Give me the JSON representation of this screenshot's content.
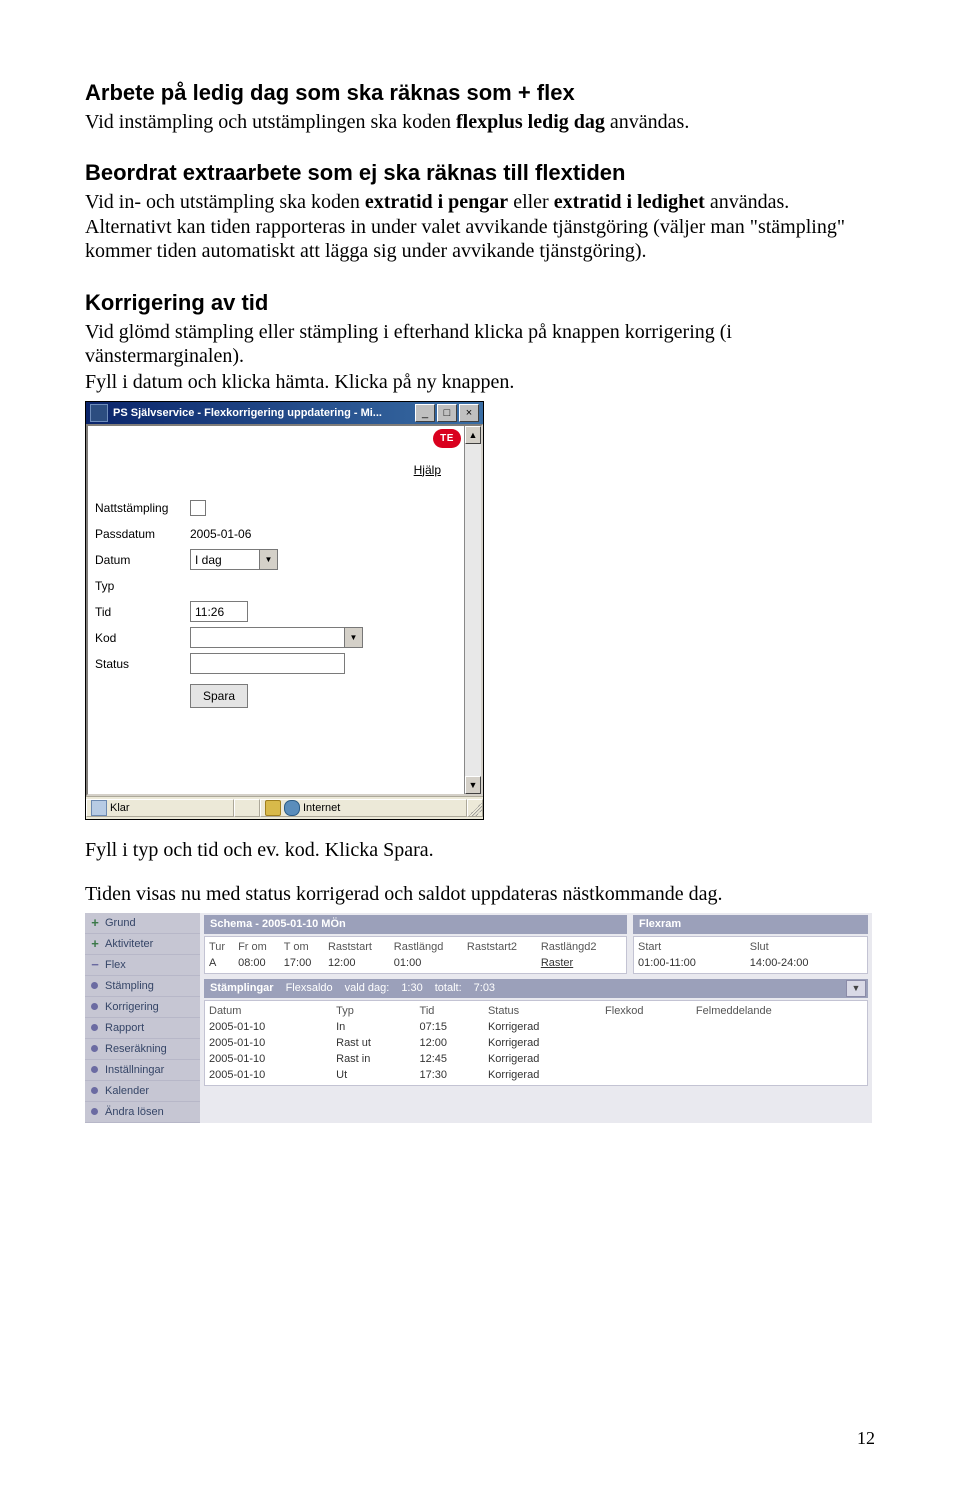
{
  "doc": {
    "h1": "Arbete på ledig dag som ska räknas som + flex",
    "p1a": "Vid instämpling och utstämplingen ska koden ",
    "p1b": "flexplus ledig dag",
    "p1c": " användas.",
    "h2": "Beordrat extraarbete som ej ska räknas till flextiden",
    "p2a": "Vid in- och utstämpling ska koden ",
    "p2b": "extratid i pengar",
    "p2c": " eller ",
    "p2d": "extratid i ledighet",
    "p2e": " användas. Alternativt kan tiden rapporteras in under valet avvikande tjänstgöring (väljer man \"stämpling\" kommer tiden automatiskt att lägga sig under avvikande tjänstgöring).",
    "h3": "Korrigering av tid",
    "p3": "Vid glömd stämpling eller stämpling i efterhand klicka på knappen korrigering (i vänstermarginalen).",
    "p3b": "Fyll i datum och klicka hämta. Klicka på ny knappen.",
    "p4": "Fyll i typ och tid och ev. kod.   Klicka Spara.",
    "p5": "Tiden visas nu med status korrigerad och saldot uppdateras nästkommande dag.",
    "page": "12"
  },
  "dlg": {
    "title": "PS Självservice - Flexkorrigering uppdatering - Mi...",
    "min": "_",
    "max": "□",
    "close": "×",
    "te": "TE",
    "help": "Hjälp",
    "labels": {
      "natt": "Nattstämpling",
      "pass": "Passdatum",
      "datum": "Datum",
      "typ": "Typ",
      "tid": "Tid",
      "kod": "Kod",
      "status": "Status"
    },
    "values": {
      "pass": "2005-01-06",
      "datum": "I dag",
      "tid": "11:26"
    },
    "spara": "Spara",
    "status_left": "Klar",
    "status_right": "Internet"
  },
  "panel": {
    "nav": [
      "Grund",
      "Aktiviteter",
      "Flex",
      "Stämpling",
      "Korrigering",
      "Rapport",
      "Reseräkning",
      "Inställningar",
      "Kalender",
      "Ändra lösen"
    ],
    "nav_types": [
      "plus",
      "plus",
      "minus",
      "dot",
      "dot",
      "dot",
      "dot",
      "dot",
      "dot",
      "dot"
    ],
    "schema_title": "Schema - 2005-01-10 MÖn",
    "schema_headers": [
      "Tur",
      "Fr om",
      "T om",
      "Raststart",
      "Rastlängd",
      "Raststart2",
      "Rastlängd2"
    ],
    "schema_row": [
      "A",
      "08:00",
      "17:00",
      "12:00",
      "01:00",
      "",
      "Raster"
    ],
    "flexram_title": "Flexram",
    "flexram_headers": [
      "Start",
      "Slut"
    ],
    "flexram_row": [
      "01:00-11:00",
      "14:00-24:00"
    ],
    "stamp_title": "Stämplingar",
    "stamp_sub1": "Flexsaldo",
    "stamp_sub2a": "vald dag:",
    "stamp_sub2b": "1:30",
    "stamp_sub3a": "totalt:",
    "stamp_sub3b": "7:03",
    "stamp_headers": [
      "Datum",
      "Typ",
      "Tid",
      "Status",
      "Flexkod",
      "Felmeddelande"
    ],
    "stamp_rows": [
      [
        "2005-01-10",
        "In",
        "07:15",
        "Korrigerad",
        "",
        ""
      ],
      [
        "2005-01-10",
        "Rast ut",
        "12:00",
        "Korrigerad",
        "",
        ""
      ],
      [
        "2005-01-10",
        "Rast in",
        "12:45",
        "Korrigerad",
        "",
        ""
      ],
      [
        "2005-01-10",
        "Ut",
        "17:30",
        "Korrigerad",
        "",
        ""
      ]
    ]
  }
}
